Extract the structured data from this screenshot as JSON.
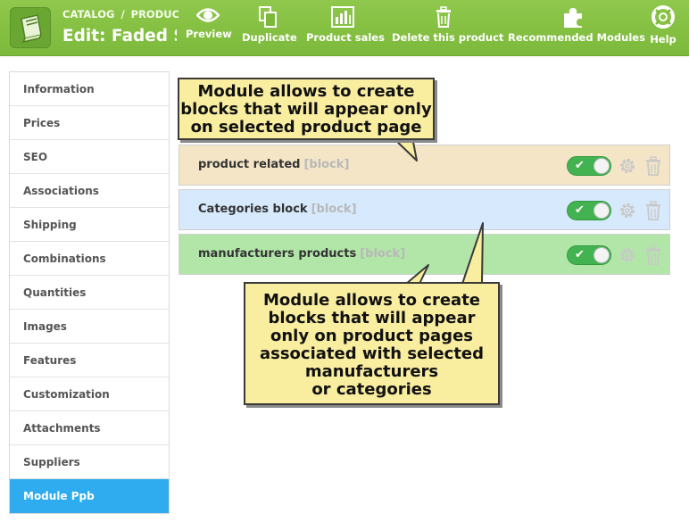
{
  "header": {
    "breadcrumb": [
      "CATALOG",
      "PRODUC"
    ],
    "breadcrumb_separator": "/",
    "title": "Edit: Faded Sl",
    "brand_color": "#8bc34a",
    "toolbar": [
      {
        "label": "Preview",
        "icon": "eye-icon"
      },
      {
        "label": "Duplicate",
        "icon": "duplicate-icon"
      },
      {
        "label": "Product sales",
        "icon": "bar-chart-icon"
      },
      {
        "label": "Delete this product",
        "icon": "trash-icon"
      },
      {
        "label": "Recommended Modules",
        "icon": "puzzle-icon"
      },
      {
        "label": "Help",
        "icon": "lifebuoy-icon"
      }
    ]
  },
  "sidebar": {
    "active_color": "#2eacef",
    "items": [
      {
        "label": "Information"
      },
      {
        "label": "Prices"
      },
      {
        "label": "SEO"
      },
      {
        "label": "Associations"
      },
      {
        "label": "Shipping"
      },
      {
        "label": "Combinations"
      },
      {
        "label": "Quantities"
      },
      {
        "label": "Images"
      },
      {
        "label": "Features"
      },
      {
        "label": "Customization"
      },
      {
        "label": "Attachments"
      },
      {
        "label": "Suppliers"
      },
      {
        "label": "Module Ppb",
        "active": true
      }
    ]
  },
  "blocks": [
    {
      "name": "product related",
      "tag": "[block]",
      "color": "#f4e5c6",
      "enabled": true
    },
    {
      "name": "Categories block",
      "tag": "[block]",
      "color": "#d7e9fc",
      "enabled": true
    },
    {
      "name": "manufacturers products",
      "tag": "[block]",
      "color": "#b2e6a8",
      "enabled": true
    }
  ],
  "callouts": {
    "top": [
      "Module allows to create",
      "blocks that will appear only",
      "on selected product page"
    ],
    "bottom": [
      "Module allows to create",
      "blocks that will appear",
      "only  on  product pages",
      "associated with selected",
      "manufacturers",
      "or categories"
    ]
  }
}
